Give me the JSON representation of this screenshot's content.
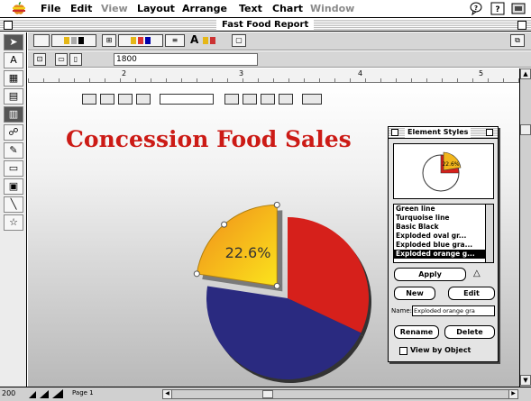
{
  "menubar": {
    "items": [
      {
        "label": "File",
        "enabled": true
      },
      {
        "label": "Edit",
        "enabled": true
      },
      {
        "label": "View",
        "enabled": false
      },
      {
        "label": "Layout",
        "enabled": true
      },
      {
        "label": "Arrange",
        "enabled": true
      },
      {
        "label": "Text",
        "enabled": true
      },
      {
        "label": "Chart",
        "enabled": true
      },
      {
        "label": "Window",
        "enabled": false
      }
    ]
  },
  "window": {
    "title": "Fast Food Report"
  },
  "toolbar": {
    "size_value": "1800"
  },
  "ruler": {
    "numbers": [
      "2",
      "3",
      "4",
      "5"
    ]
  },
  "canvas": {
    "title": "Concession Food Sales",
    "title_color": "#cc1b16",
    "slice_label": "22.6%"
  },
  "chart_data": {
    "type": "pie",
    "title": "Concession Food Sales",
    "slices": [
      {
        "value": 22.6,
        "color": "#f2b61c",
        "exploded": true,
        "label": "22.6%"
      },
      {
        "value": 32.0,
        "color": "#d6201b",
        "exploded": false
      },
      {
        "value": 45.4,
        "color": "#2a2a80",
        "exploded": false
      }
    ]
  },
  "styles_panel": {
    "title": "Element Styles",
    "preview_label": "22.6%",
    "styles": [
      {
        "label": "Green line",
        "selected": false
      },
      {
        "label": "Turquoise line",
        "selected": false
      },
      {
        "label": "Basic Black",
        "selected": false
      },
      {
        "label": "Exploded oval gr...",
        "selected": false
      },
      {
        "label": "Exploded blue gra...",
        "selected": false
      },
      {
        "label": "Exploded orange g...",
        "selected": true
      }
    ],
    "apply_label": "Apply",
    "new_label": "New",
    "edit_label": "Edit",
    "name_label": "Name:",
    "name_value": "Exploded orange gra",
    "rename_label": "Rename",
    "delete_label": "Delete",
    "view_by_object_label": "View by Object",
    "view_by_object_checked": false
  },
  "statusbar": {
    "zoom": "200",
    "page_label": "Page 1"
  }
}
